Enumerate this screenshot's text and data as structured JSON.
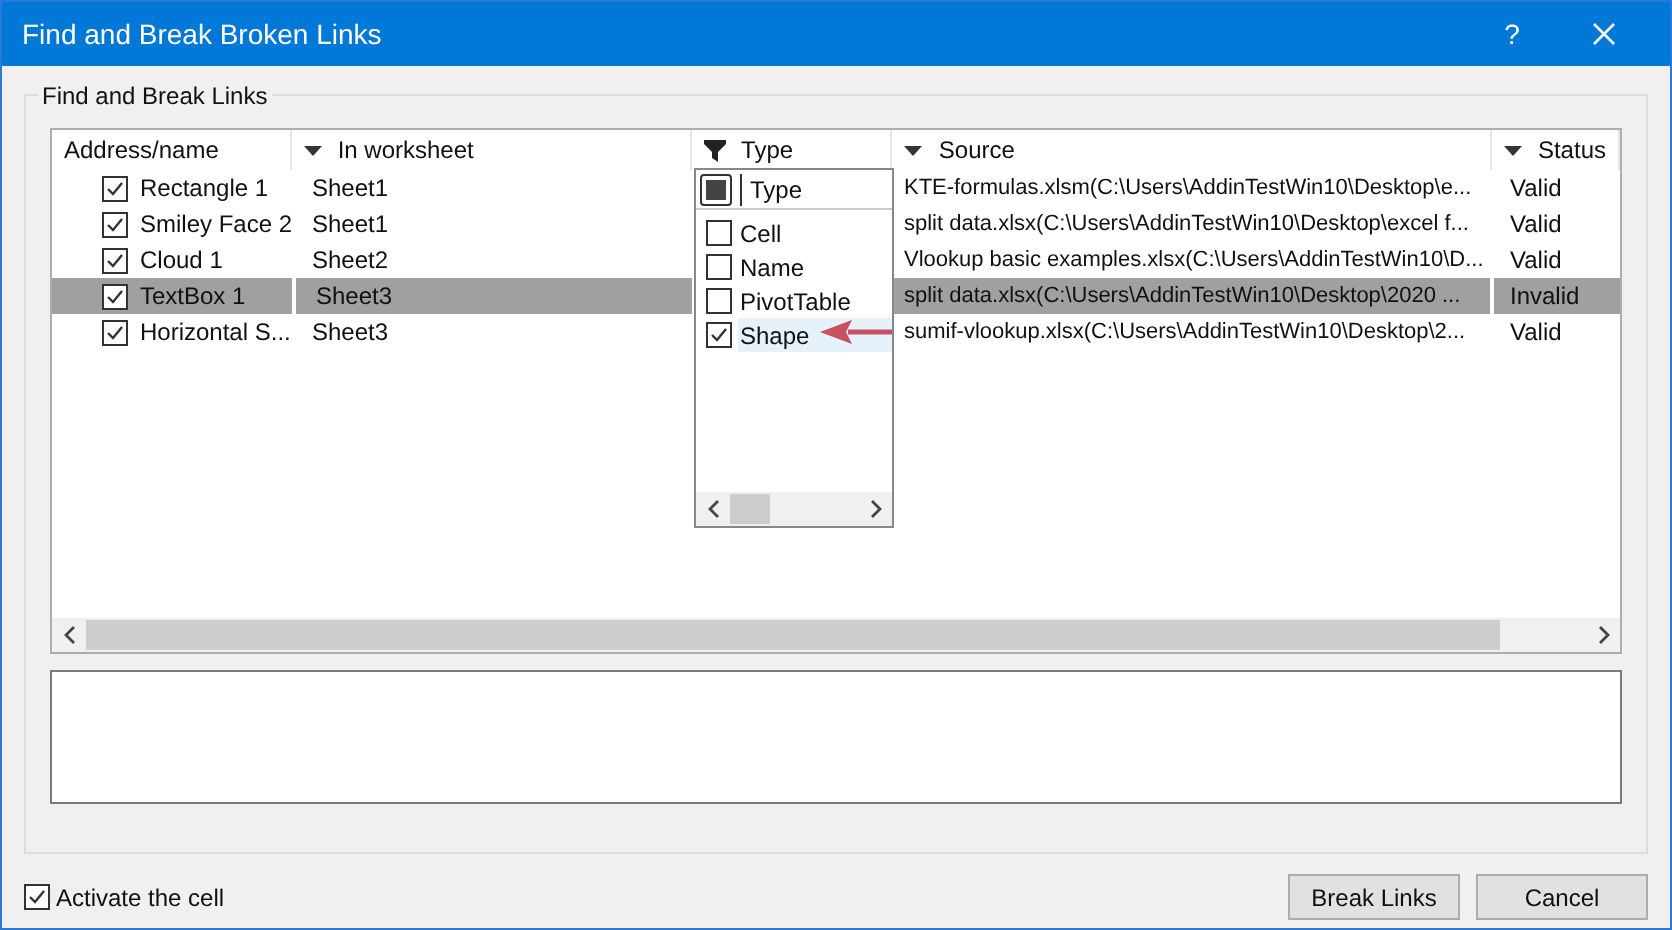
{
  "window": {
    "title": "Find and Break Broken Links",
    "help": "?"
  },
  "group": {
    "label": "Find and Break Links"
  },
  "table": {
    "columns": [
      {
        "label": "Address/name",
        "kind": "plain"
      },
      {
        "label": "In worksheet",
        "kind": "dropdown"
      },
      {
        "label": "Type",
        "kind": "filter"
      },
      {
        "label": "Source",
        "kind": "dropdown"
      },
      {
        "label": "Status",
        "kind": "dropdown"
      }
    ],
    "rows": [
      {
        "name": "Rectangle 1",
        "checked": true,
        "worksheet": "Sheet1",
        "source": "KTE-formulas.xlsm(C:\\Users\\AddinTestWin10\\Desktop\\e...",
        "status": "Valid",
        "selected": false
      },
      {
        "name": "Smiley Face 2",
        "checked": true,
        "worksheet": "Sheet1",
        "source": "split data.xlsx(C:\\Users\\AddinTestWin10\\Desktop\\excel f...",
        "status": "Valid",
        "selected": false
      },
      {
        "name": "Cloud 1",
        "checked": true,
        "worksheet": "Sheet2",
        "source": "Vlookup basic examples.xlsx(C:\\Users\\AddinTestWin10\\D...",
        "status": "Valid",
        "selected": false
      },
      {
        "name": "TextBox 1",
        "checked": true,
        "worksheet": "Sheet3",
        "source": "split data.xlsx(C:\\Users\\AddinTestWin10\\Desktop\\2020 ...",
        "status": "Invalid",
        "selected": true
      },
      {
        "name": "Horizontal S...",
        "checked": true,
        "worksheet": "Sheet3",
        "source": "sumif-vlookup.xlsx(C:\\Users\\AddinTestWin10\\Desktop\\2...",
        "status": "Valid",
        "selected": false
      }
    ]
  },
  "filter_menu": {
    "header": {
      "label": "Type",
      "partial": true
    },
    "items": [
      {
        "label": "Cell",
        "checked": false,
        "selected": false
      },
      {
        "label": "Name",
        "checked": false,
        "selected": false
      },
      {
        "label": "PivotTable",
        "checked": false,
        "selected": false
      },
      {
        "label": "Shape",
        "checked": true,
        "selected": true
      }
    ]
  },
  "activate": {
    "label": "Activate the cell",
    "checked": true
  },
  "buttons": [
    {
      "label": "Break Links"
    },
    {
      "label": "Cancel"
    }
  ]
}
